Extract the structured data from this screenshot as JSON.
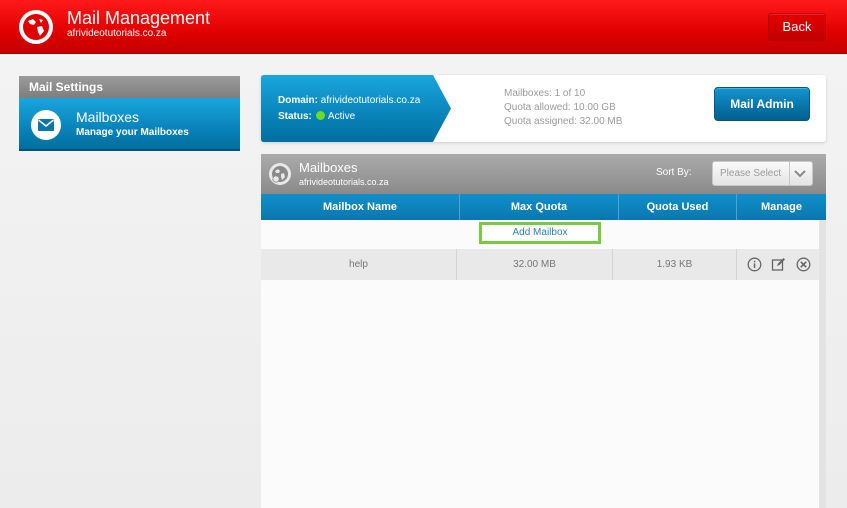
{
  "header": {
    "title": "Mail Management",
    "subtitle": "afrivideotutorials.co.za",
    "back_label": "Back"
  },
  "sidebar": {
    "section_title": "Mail Settings",
    "items": [
      {
        "title": "Mailboxes",
        "subtitle": "Manage your Mailboxes",
        "icon": "envelope-icon"
      }
    ]
  },
  "domain_info": {
    "domain_label": "Domain:",
    "domain_value": "afrivideotutorials.co.za",
    "status_label": "Status:",
    "status_value": "Active",
    "status_color": "#6edc1f",
    "mailboxes": "Mailboxes: 1 of 10",
    "quota_allowed": "Quota allowed: 10.00 GB",
    "quota_assigned": "Quota assigned: 32.00 MB",
    "mail_admin_label": "Mail Admin"
  },
  "mailboxes_panel": {
    "title": "Mailboxes",
    "subtitle": "afrivideotutorials.co.za",
    "sort_label": "Sort By:",
    "sort_selected": "Please Select",
    "columns": [
      "Mailbox Name",
      "Max Quota",
      "Quota Used",
      "Manage"
    ],
    "add_label": "Add Mailbox",
    "rows": [
      {
        "name": "help",
        "max_quota": "32.00 MB",
        "quota_used": "1.93 KB"
      }
    ]
  },
  "colors": {
    "header_red": "#e00000",
    "accent_blue": "#0a86bd",
    "highlight_green": "#7ac943"
  }
}
